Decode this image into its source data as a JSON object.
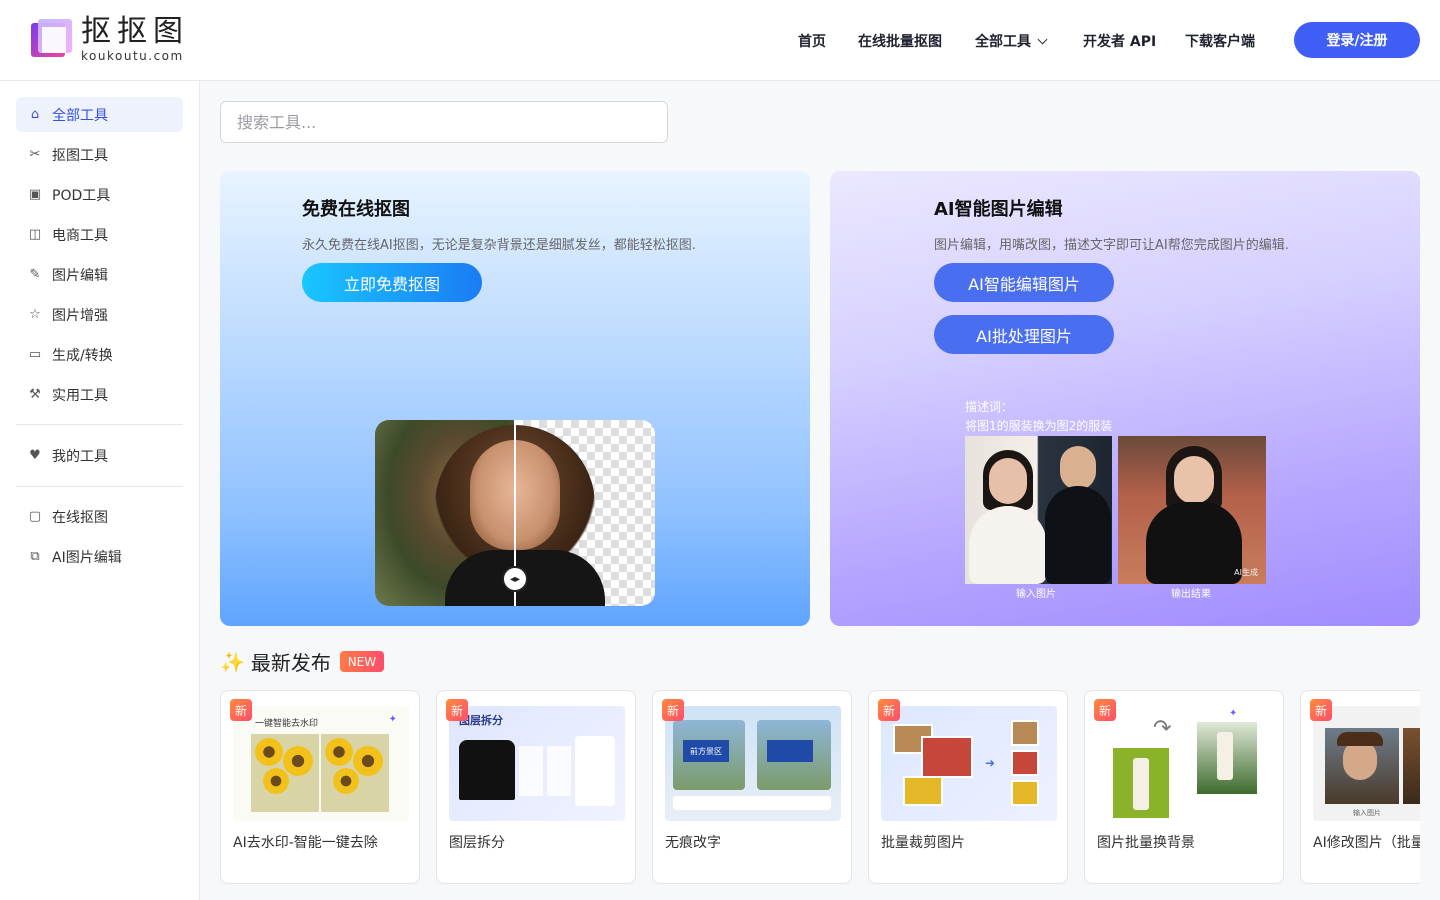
{
  "header": {
    "logo_cn": "抠抠图",
    "logo_en": "koukoutu.com",
    "nav": [
      "首页",
      "在线批量抠图",
      "全部工具",
      "开发者 API",
      "下载客户端"
    ],
    "login": "登录/注册"
  },
  "sidebar": {
    "items": [
      {
        "label": "全部工具",
        "icon": "home-icon"
      },
      {
        "label": "抠图工具",
        "icon": "scissors-icon"
      },
      {
        "label": "POD工具",
        "icon": "shirt-icon"
      },
      {
        "label": "电商工具",
        "icon": "bag-icon"
      },
      {
        "label": "图片编辑",
        "icon": "pen-icon"
      },
      {
        "label": "图片增强",
        "icon": "star-icon"
      },
      {
        "label": "生成/转换",
        "icon": "monitor-icon"
      },
      {
        "label": "实用工具",
        "icon": "wrench-icon"
      }
    ],
    "my_tools": "我的工具",
    "links": [
      "在线抠图",
      "AI图片编辑"
    ]
  },
  "search": {
    "placeholder": "搜索工具..."
  },
  "banner_left": {
    "title": "免费在线抠图",
    "subtitle": "永久免费在线AI抠图，无论是复杂背景还是细腻发丝，都能轻松抠图.",
    "button": "立即免费抠图"
  },
  "banner_right": {
    "title": "AI智能图片编辑",
    "subtitle": "图片编辑，用嘴改图，描述文字即可让AI帮您完成图片的编辑.",
    "button1": "AI智能编辑图片",
    "button2": "AI批处理图片",
    "caption1": "描述词：",
    "caption2": "将图1的服装换为图2的服装",
    "label_in": "输入图片",
    "label_out": "输出结果",
    "watermark": "AI生成"
  },
  "latest": {
    "title": "最新发布",
    "badge": "NEW",
    "new_tag": "新",
    "cards": [
      {
        "name": "AI去水印-智能一键去除",
        "thumb_text": "一键智能去水印"
      },
      {
        "name": "图层拆分",
        "thumb_text": "图层拆分"
      },
      {
        "name": "无痕改字",
        "thumb_text": "前方景区"
      },
      {
        "name": "批量裁剪图片",
        "thumb_text": ""
      },
      {
        "name": "图片批量换背景",
        "thumb_text": ""
      },
      {
        "name": "AI修改图片（批量编辑）",
        "thumb_text": "输入图片"
      }
    ]
  },
  "colors": {
    "accent": "#3e5ef6",
    "active_bg": "#eef2fd"
  }
}
